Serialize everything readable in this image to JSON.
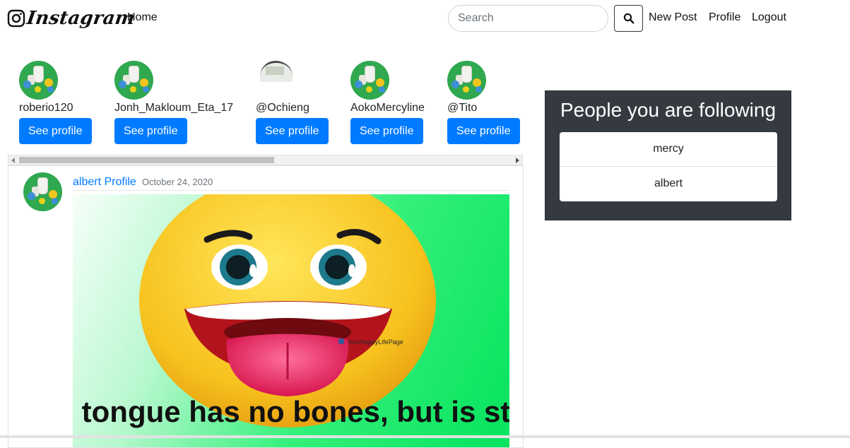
{
  "navbar": {
    "brand": "Instagram",
    "home": "Home",
    "search_placeholder": "Search",
    "new_post": "New Post",
    "profile": "Profile",
    "logout": "Logout"
  },
  "profiles": [
    {
      "username": "roberio120",
      "button": "See profile"
    },
    {
      "username": "Jonh_Makloum_Eta_17",
      "button": "See profile"
    },
    {
      "username": "@Ochieng",
      "button": "See profile"
    },
    {
      "username": "AokoMercyline",
      "button": "See profile"
    },
    {
      "username": "@Tito",
      "button": "See profile"
    }
  ],
  "post": {
    "author": "albert Profile",
    "date": "October 24, 2020",
    "image_caption": "“The tongue has no bones, but is strong",
    "image_watermark": "YourHappyLifePage"
  },
  "following": {
    "title": "People you are following",
    "items": [
      "mercy",
      "albert"
    ]
  },
  "colors": {
    "primary": "#007bff",
    "panel_dark": "#343a40",
    "avatar_green": "#2fa84f",
    "post_bg_green": "#06e35e",
    "emoji_yellow": "#f7c21e"
  },
  "icons": {
    "brand": "instagram-camera-icon",
    "search_button": "search-icon"
  }
}
